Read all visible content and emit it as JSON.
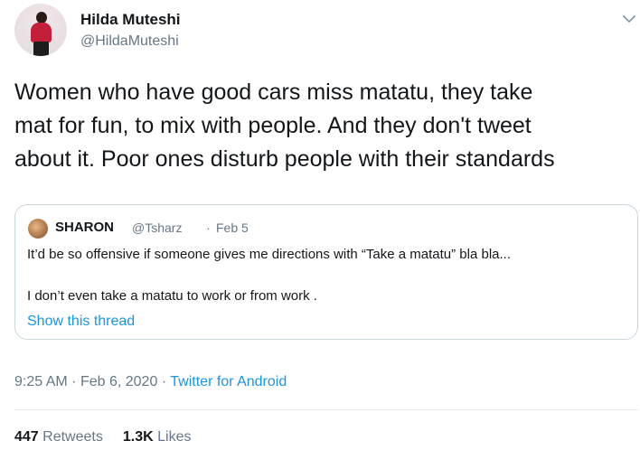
{
  "author": {
    "display_name": "Hilda Muteshi",
    "handle": "@HildaMuteshi"
  },
  "tweet": {
    "lines": [
      "Women who have good cars miss matatu, they take",
      "mat for fun, to mix with people. And they don't tweet",
      "about it. Poor ones disturb people with their standards"
    ]
  },
  "quoted_tweet": {
    "display_name": "SHARON",
    "handle": "@Tsharz",
    "separator": "·",
    "date": "Feb 5",
    "line1": "It’d be so offensive if someone gives me directions with “Take a matatu” bla bla...",
    "line2": "I don’t even take a matatu to work or from work .",
    "show_thread": "Show this thread"
  },
  "meta": {
    "time": "9:25 AM",
    "separator": "·",
    "date": "Feb 6, 2020",
    "source": "Twitter for Android"
  },
  "stats": {
    "retweets_count": "447",
    "retweets_label": "Retweets",
    "likes_count": "1.3K",
    "likes_label": "Likes"
  },
  "icons": {
    "more": "chevron-down-icon"
  }
}
